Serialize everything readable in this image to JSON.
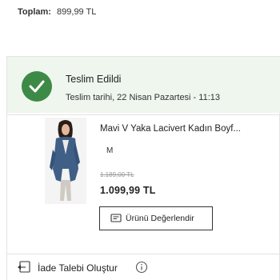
{
  "total": {
    "label": "Toplam:",
    "value": "899,99 TL"
  },
  "status": {
    "title": "Teslim Edildi",
    "date_text": "Teslim tarihi, 22 Nisan Pazartesi - 11:13",
    "color": "#3d8a47",
    "icon": "check-icon"
  },
  "product": {
    "name": "Mavi V Yaka Lacivert Kadın Boyf...",
    "size": "M",
    "old_price": "1.189,00 TL",
    "price": "1.099,99 TL",
    "image": "product-photo"
  },
  "review_button": {
    "label": "Ürünü Değerlendir",
    "icon": "review-icon"
  },
  "return_request": {
    "label": "İade Talebi Oluştur",
    "icon": "return-icon",
    "info_icon": "info-icon"
  }
}
